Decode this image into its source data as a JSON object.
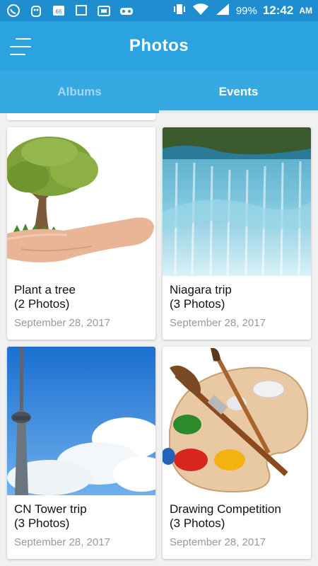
{
  "status_bar": {
    "battery": "99%",
    "time": "12:42",
    "ampm": "AM",
    "icons": [
      "whatsapp-icon",
      "owl-icon",
      "notification-66-icon",
      "screen-icon",
      "tv-icon",
      "game-icon"
    ]
  },
  "app_bar": {
    "title": "Photos"
  },
  "tabs": [
    {
      "label": "Albums",
      "active": false
    },
    {
      "label": "Events",
      "active": true
    }
  ],
  "events": [
    {
      "title": "Plant a tree",
      "count": "(2 Photos)",
      "date": "September 28, 2017"
    },
    {
      "title": "Niagara trip",
      "count": "(3 Photos)",
      "date": "September 28, 2017"
    },
    {
      "title": "CN Tower trip",
      "count": "(3 Photos)",
      "date": "September 28, 2017"
    },
    {
      "title": "Drawing Competition",
      "count": "(3 Photos)",
      "date": "September 28, 2017"
    }
  ],
  "colors": {
    "primary": "#2ba3e0",
    "status": "#1e8ed0",
    "tabs": "#36a8e2"
  }
}
